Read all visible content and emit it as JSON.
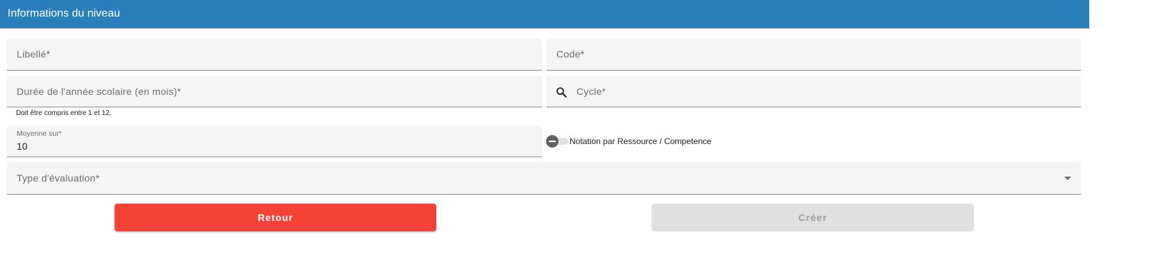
{
  "header": {
    "title": "Informations du niveau"
  },
  "form": {
    "libelle": {
      "label": "Libellé*"
    },
    "code": {
      "label": "Code*"
    },
    "duree": {
      "label": "Durée de l'année scolaire (en mois)*",
      "hint": "Doit être compris entre 1 et 12."
    },
    "cycle": {
      "label": "Cycle*",
      "icon": "search-icon"
    },
    "moyenne": {
      "label": "Moyenne sur*",
      "value": "10"
    },
    "notation": {
      "label": "Notation par Ressource / Competence",
      "checked": false
    },
    "type_evaluation": {
      "label": "Type d'évaluation*",
      "icon": "arrow-drop-down-icon"
    }
  },
  "actions": {
    "back_label": "Retour",
    "create_label": "Créer"
  },
  "colors": {
    "header": "#2a7fbb",
    "back_button": "#f44336",
    "create_button_disabled": "#e0e0e0"
  }
}
